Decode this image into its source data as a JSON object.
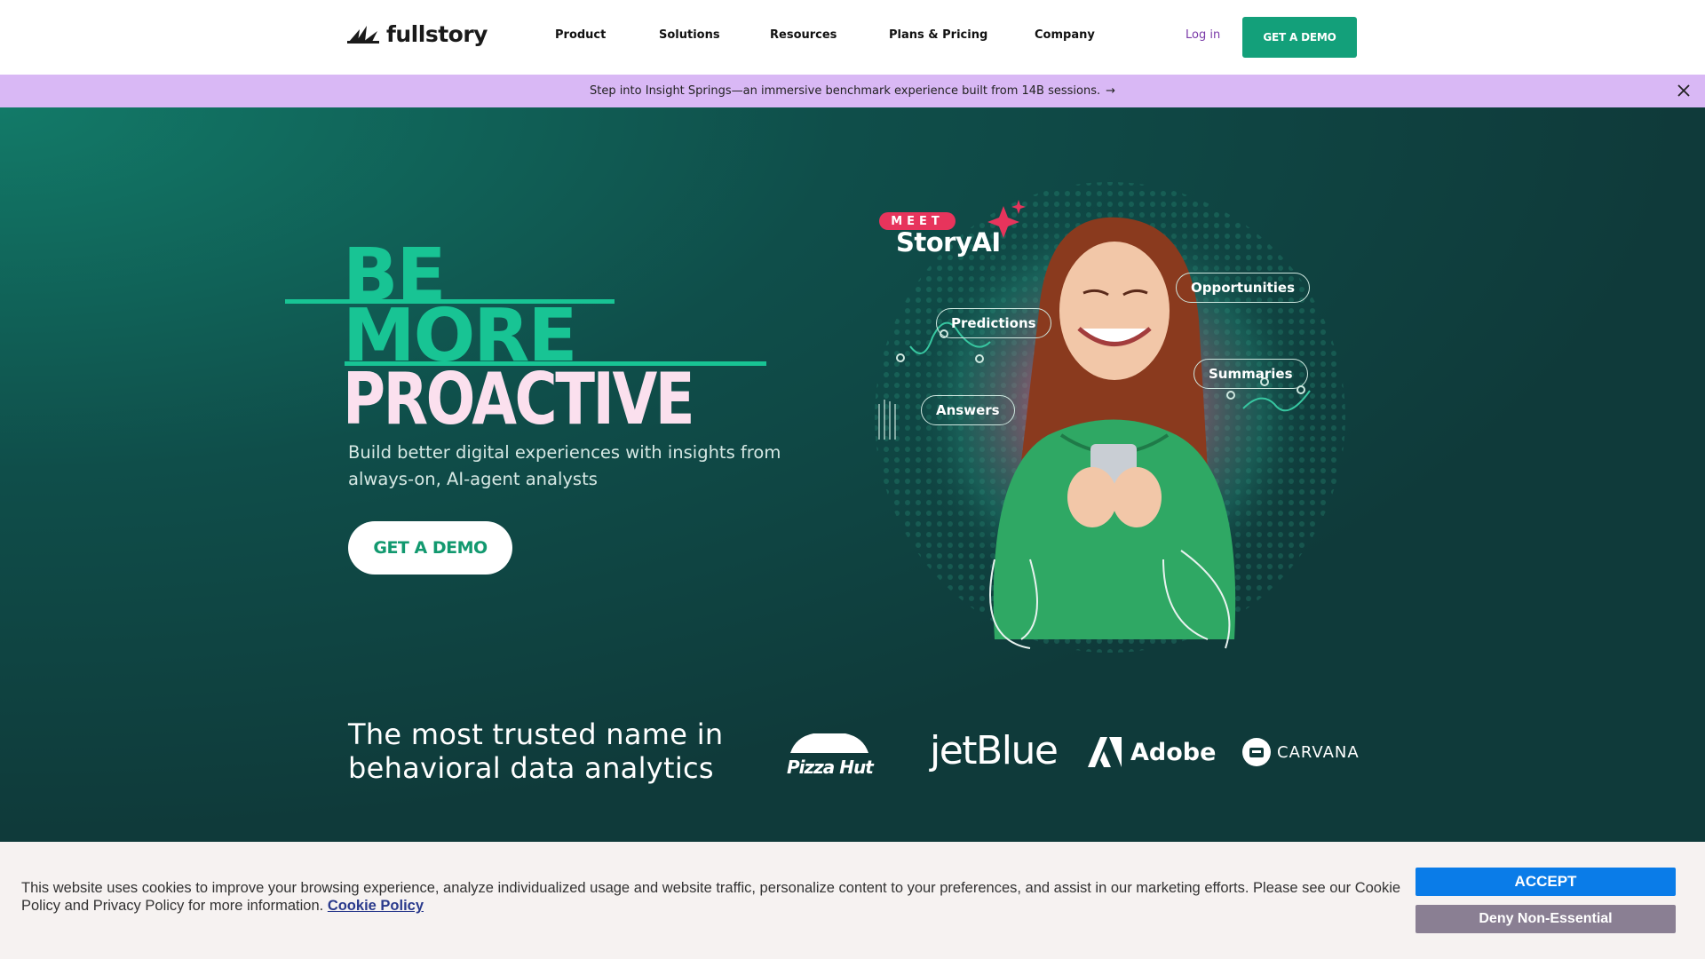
{
  "nav": {
    "logo_text": "fullstory",
    "links": [
      "Product",
      "Solutions",
      "Resources",
      "Plans & Pricing",
      "Company"
    ],
    "login": "Log in",
    "demo": "GET A DEMO"
  },
  "announcement": {
    "text": "Step into Insight Springs—an immersive benchmark experience built from 14B sessions.",
    "arrow": "→"
  },
  "hero": {
    "line_be": "BE",
    "line_more": "MORE",
    "line_proactive": "PROACTIVE",
    "subtitle": "Build better digital experiences with insights from always-on, AI-agent analysts",
    "cta": "GET A DEMO",
    "illustration": {
      "meet": "MEET",
      "title": "StoryAI",
      "pills": [
        "Opportunities",
        "Predictions",
        "Summaries",
        "Answers"
      ]
    }
  },
  "trusted": {
    "heading": "The most trusted name in behavioral data analytics",
    "brands": [
      "Pizza Hut",
      "jetBlue",
      "Adobe",
      "CARVANA"
    ]
  },
  "cookie": {
    "text": "This website uses cookies to improve your browsing experience, analyze individualized usage and website traffic, personalize content to your preferences, and assist in our marketing efforts. Please see our Cookie Policy and Privacy Policy for more information.",
    "link": "Cookie Policy",
    "accept": "ACCEPT",
    "deny": "Deny Non-Essential"
  },
  "colors": {
    "accent_green": "#13a07a",
    "hero_bg": "#0f3a3a",
    "announce_bg": "#d9b8f5",
    "accept_blue": "#0a7ce8",
    "deny_gray": "#8a7f93"
  }
}
